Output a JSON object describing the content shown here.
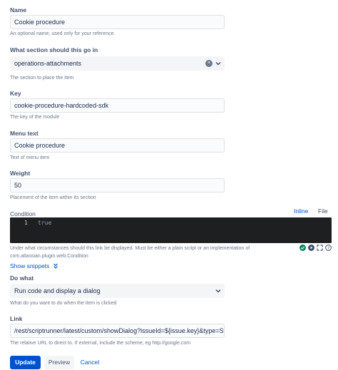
{
  "name": {
    "label": "Name",
    "value": "Cookie procedure",
    "helper": "An optional name, used only for your reference."
  },
  "section": {
    "label": "What section should this go in",
    "value": "operations-attachments",
    "helper": "The section to place the item"
  },
  "key": {
    "label": "Key",
    "value": "cookie-procedure-hardcoded-sdk",
    "helper": "The key of the module"
  },
  "menu_text": {
    "label": "Menu text",
    "value": "Cookie procedure",
    "helper": "Text of menu item"
  },
  "weight": {
    "label": "Weight",
    "value": "50",
    "helper": "Placement of the item within its section"
  },
  "condition": {
    "label": "Condition",
    "tabs": [
      "Inline",
      "File"
    ],
    "line_number": "1",
    "code": "true",
    "helper_line1": "Under what circumstances should this link be displayed. Must be either a plain script or an implementation of",
    "helper_line2": "com.atlassian.plugin.web.Condition",
    "show_snippets": "Show snippets"
  },
  "do_what": {
    "label": "Do what",
    "value": "Run code and display a dialog",
    "helper": "What do you want to do when the item is clicked"
  },
  "link": {
    "label": "Link",
    "value": "/rest/scriptrunner/latest/custom/showDialog?issueId=${issue.key}&type=SDK",
    "helper": "The relative URL to direct to. If external, include the scheme, eg http://google.com"
  },
  "buttons": {
    "update": "Update",
    "preview": "Preview",
    "cancel": "Cancel"
  },
  "colors": {
    "primary": "#0052cc",
    "editor_bg": "#1d1f21",
    "success": "#00875a"
  }
}
